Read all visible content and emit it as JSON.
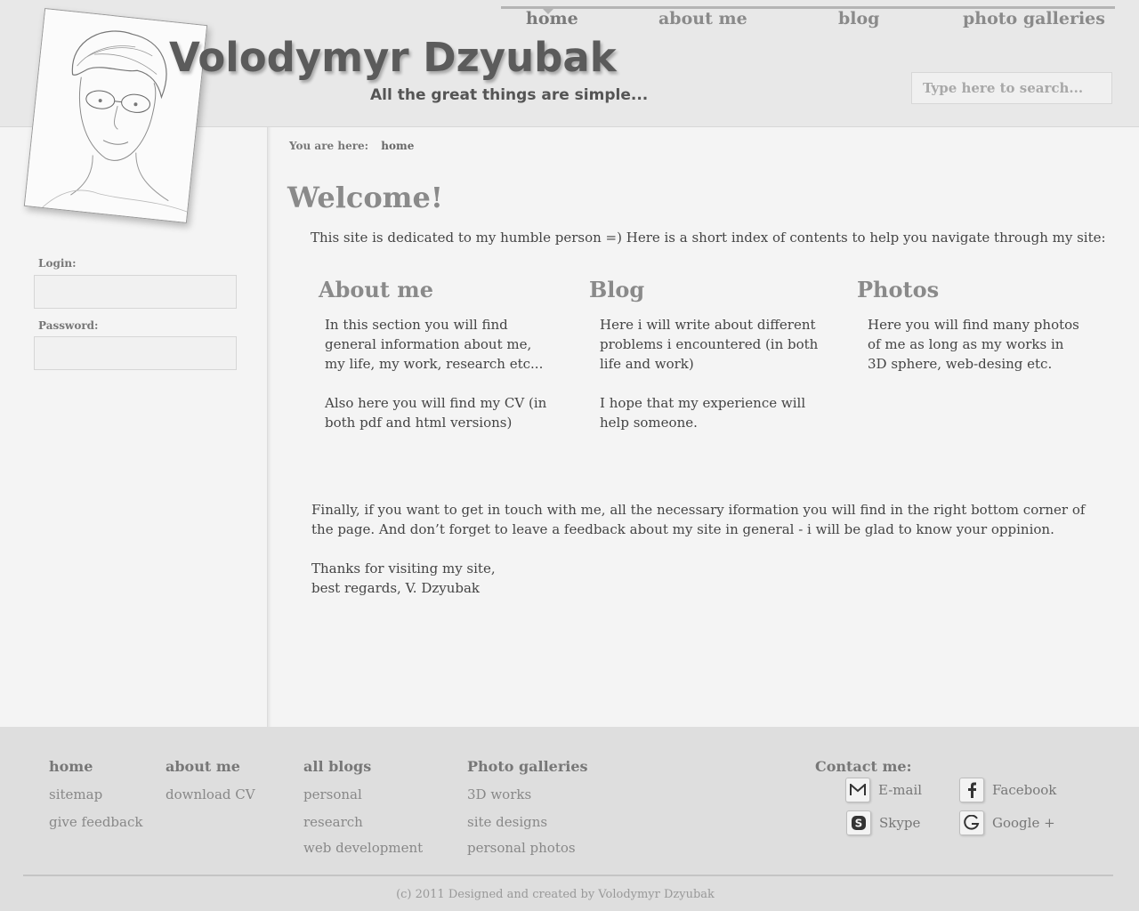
{
  "header": {
    "title": "Volodymyr Dzyubak",
    "tagline": "All the great things are simple...",
    "search_placeholder": "Type here to search...",
    "nav": [
      {
        "label": "home",
        "active": true
      },
      {
        "label": "about me",
        "active": false
      },
      {
        "label": "blog",
        "active": false
      },
      {
        "label": "photo galleries",
        "active": false
      }
    ]
  },
  "sidebar": {
    "login_label": "Login:",
    "password_label": "Password:"
  },
  "breadcrumb": {
    "prefix": "You are here:",
    "current": "home"
  },
  "main": {
    "heading": "Welcome!",
    "intro": "This site is dedicated to my humble person =)  Here is a short index of contents to help you navigate through my site:",
    "columns": [
      {
        "title": "About me",
        "paragraphs": [
          "In this section you will find general  information about me, my life, my work, research etc...",
          "Also here you will find my CV (in both pdf and html versions)"
        ]
      },
      {
        "title": "Blog",
        "paragraphs": [
          "Here i will write about different problems i encountered (in both life and work)",
          "I hope that my experience will help someone."
        ]
      },
      {
        "title": "Photos",
        "paragraphs": [
          "Here you will find many photos of me as long as my works in 3D sphere, web-desing etc."
        ]
      }
    ],
    "closing": [
      "Finally, if you want to get in touch with me, all the necessary iformation you will find in the right bottom corner of the page. And don’t forget to leave a feedback about my site in general - i will be glad to know your oppinion.",
      "Thanks for visiting my site,",
      "best regards, V. Dzyubak"
    ]
  },
  "footer": {
    "columns": [
      {
        "head": "home",
        "links": [
          "sitemap",
          "give feedback"
        ]
      },
      {
        "head": "about me",
        "links": [
          "download CV"
        ]
      },
      {
        "head": "all blogs",
        "links": [
          "personal",
          "research",
          "web development"
        ]
      },
      {
        "head": "Photo galleries",
        "links": [
          "3D works",
          "site designs",
          "personal photos"
        ]
      }
    ],
    "contact_head": "Contact me:",
    "contacts": [
      {
        "label": "E-mail",
        "icon": "gmail-icon"
      },
      {
        "label": "Facebook",
        "icon": "facebook-icon"
      },
      {
        "label": "Skype",
        "icon": "skype-icon"
      },
      {
        "label": "Google +",
        "icon": "google-plus-icon"
      }
    ],
    "copyright": "(c) 2011  Designed and created by Volodymyr Dzyubak"
  }
}
